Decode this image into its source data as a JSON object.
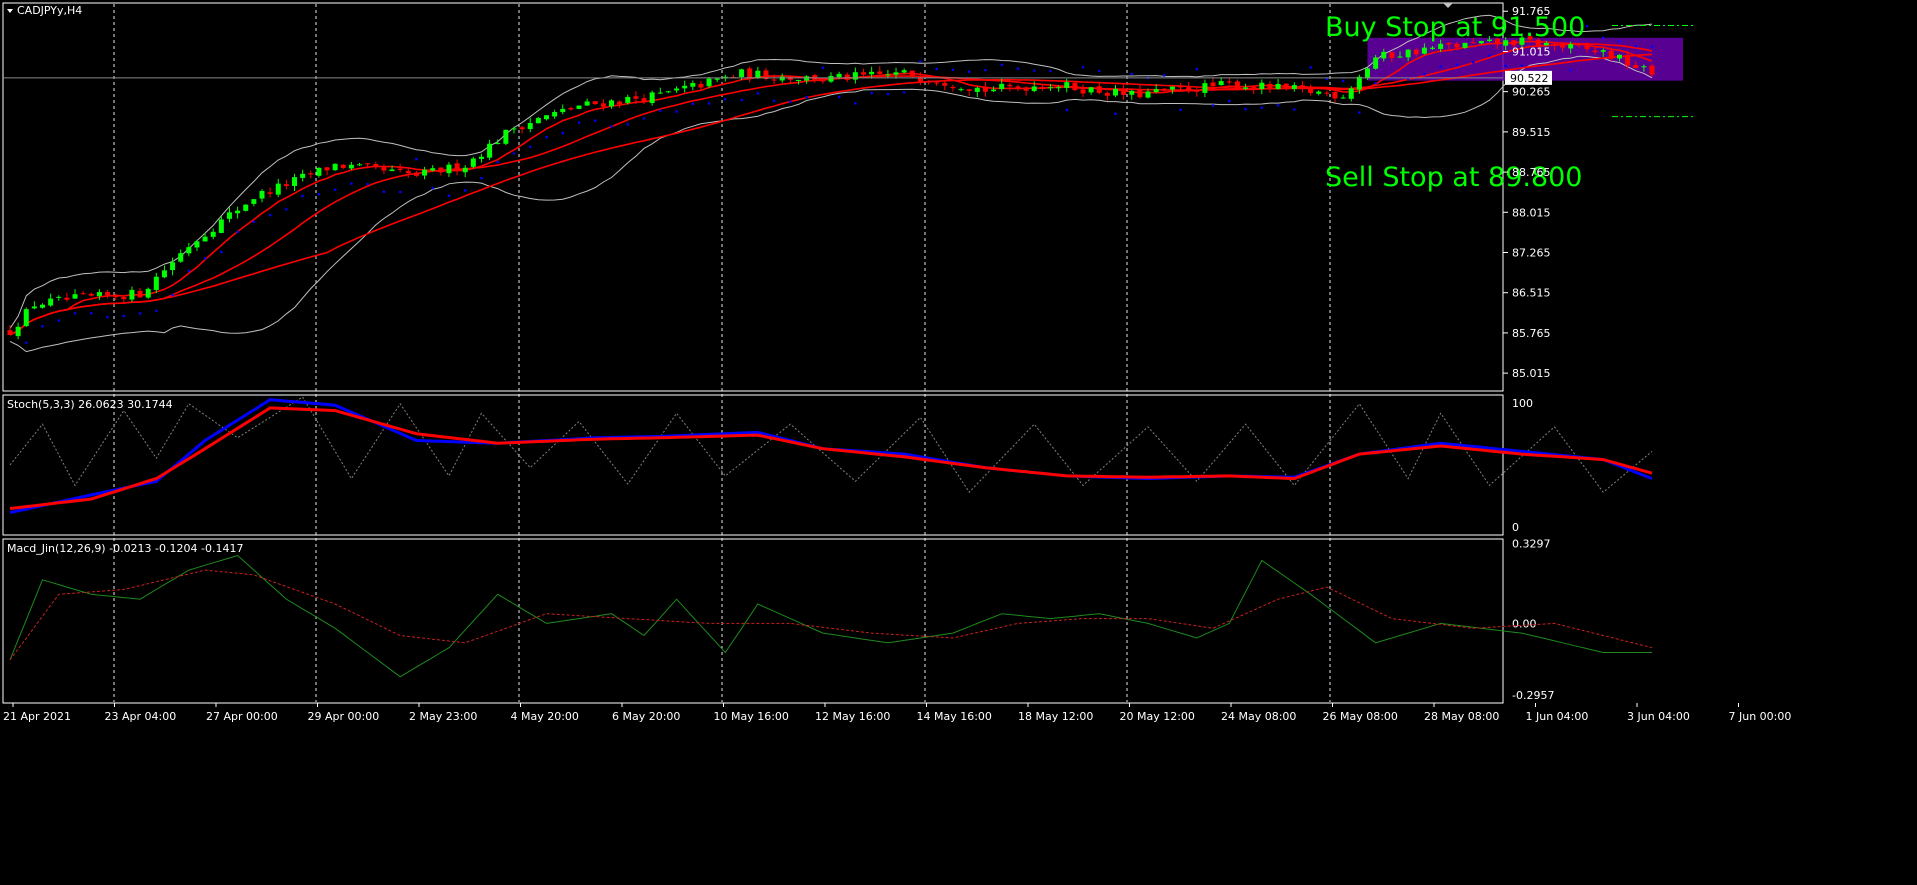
{
  "symbol_label": "CADJPYy,H4",
  "colors": {
    "background": "#000000",
    "frame": "#ffffff",
    "grid": "#ffffff",
    "bull_candle": "#00ff00",
    "bear_candle": "#ff0000",
    "ma_line": "#ff0000",
    "bollinger": "#c0c0c0",
    "sar_dots": "#0000ff",
    "annotation_text": "#00ff00",
    "box_fill": "#6600aa",
    "stoch_main": "#0000ff",
    "stoch_signal": "#ff0000",
    "macd_main": "#1e8a1e",
    "macd_signal": "#c82020",
    "text": "#ffffff"
  },
  "time_labels": [
    "21 Apr 2021",
    "23 Apr 04:00",
    "27 Apr 00:00",
    "29 Apr 00:00",
    "2 May 23:00",
    "4 May 20:00",
    "6 May 20:00",
    "10 May 16:00",
    "12 May 16:00",
    "14 May 16:00",
    "18 May 12:00",
    "20 May 12:00",
    "24 May 08:00",
    "26 May 08:00",
    "28 May 08:00",
    "1 Jun 04:00",
    "3 Jun 04:00",
    "7 Jun 00:00"
  ],
  "chart_data": [
    {
      "type": "candlestick",
      "name": "CADJPYy,H4",
      "ylim": [
        84.7,
        91.9
      ],
      "y_ticks": [
        "91.765",
        "91.015",
        "90.265",
        "89.515",
        "88.765",
        "88.015",
        "87.265",
        "86.515",
        "85.765",
        "85.015"
      ],
      "current_price": "90.522",
      "annotations": [
        "Buy Stop at 91.500",
        "Sell Stop at 89.800"
      ],
      "buy_stop": 91.5,
      "sell_stop": 89.8,
      "trend_anchors": [
        [
          0,
          85.8
        ],
        [
          3,
          86.3
        ],
        [
          8,
          86.4
        ],
        [
          16,
          86.5
        ],
        [
          22,
          87.4
        ],
        [
          30,
          88.3
        ],
        [
          40,
          88.9
        ],
        [
          50,
          88.7
        ],
        [
          56,
          88.9
        ],
        [
          62,
          89.6
        ],
        [
          70,
          90.0
        ],
        [
          80,
          90.2
        ],
        [
          90,
          90.6
        ],
        [
          100,
          90.5
        ],
        [
          110,
          90.6
        ],
        [
          120,
          90.3
        ],
        [
          128,
          90.4
        ],
        [
          138,
          90.2
        ],
        [
          150,
          90.4
        ],
        [
          158,
          90.3
        ],
        [
          164,
          90.2
        ],
        [
          168,
          90.9
        ],
        [
          176,
          91.1
        ],
        [
          186,
          91.2
        ],
        [
          196,
          91.0
        ],
        [
          202,
          90.6
        ]
      ]
    },
    {
      "type": "line",
      "name": "Stoch",
      "title": "Stoch(5,3,3) 26.0623 30.1744",
      "ylim": [
        0,
        100
      ],
      "y_ticks": [
        "100",
        "0"
      ],
      "main_anchors": [
        [
          0,
          15
        ],
        [
          10,
          28
        ],
        [
          18,
          38
        ],
        [
          24,
          68
        ],
        [
          32,
          98
        ],
        [
          40,
          94
        ],
        [
          50,
          68
        ],
        [
          60,
          66
        ],
        [
          72,
          70
        ],
        [
          80,
          71
        ],
        [
          92,
          74
        ],
        [
          100,
          62
        ],
        [
          110,
          58
        ],
        [
          120,
          48
        ],
        [
          130,
          42
        ],
        [
          140,
          40
        ],
        [
          150,
          42
        ],
        [
          158,
          41
        ],
        [
          166,
          58
        ],
        [
          176,
          66
        ],
        [
          186,
          60
        ],
        [
          196,
          54
        ],
        [
          202,
          40
        ]
      ],
      "signal_anchors": [
        [
          0,
          18
        ],
        [
          10,
          25
        ],
        [
          18,
          40
        ],
        [
          24,
          62
        ],
        [
          32,
          92
        ],
        [
          40,
          90
        ],
        [
          50,
          73
        ],
        [
          60,
          66
        ],
        [
          72,
          69
        ],
        [
          80,
          70
        ],
        [
          92,
          72
        ],
        [
          100,
          62
        ],
        [
          110,
          56
        ],
        [
          120,
          48
        ],
        [
          130,
          42
        ],
        [
          140,
          41
        ],
        [
          150,
          42
        ],
        [
          158,
          40
        ],
        [
          166,
          58
        ],
        [
          176,
          64
        ],
        [
          186,
          58
        ],
        [
          196,
          54
        ],
        [
          202,
          44
        ]
      ],
      "dotted_anchors": [
        [
          0,
          50
        ],
        [
          4,
          80
        ],
        [
          8,
          35
        ],
        [
          14,
          90
        ],
        [
          18,
          55
        ],
        [
          22,
          95
        ],
        [
          28,
          70
        ],
        [
          36,
          100
        ],
        [
          42,
          40
        ],
        [
          48,
          95
        ],
        [
          54,
          42
        ],
        [
          58,
          88
        ],
        [
          64,
          48
        ],
        [
          70,
          82
        ],
        [
          76,
          36
        ],
        [
          82,
          88
        ],
        [
          88,
          42
        ],
        [
          96,
          80
        ],
        [
          104,
          38
        ],
        [
          112,
          85
        ],
        [
          118,
          30
        ],
        [
          126,
          80
        ],
        [
          132,
          35
        ],
        [
          140,
          78
        ],
        [
          146,
          38
        ],
        [
          152,
          80
        ],
        [
          158,
          35
        ],
        [
          166,
          95
        ],
        [
          172,
          40
        ],
        [
          176,
          88
        ],
        [
          182,
          35
        ],
        [
          190,
          78
        ],
        [
          196,
          30
        ],
        [
          202,
          60
        ]
      ]
    },
    {
      "type": "line",
      "name": "Macd_Jin",
      "title": "Macd_Jin(12,26,9) -0.0213 -0.1204 -0.1417",
      "ylim": [
        -0.32,
        0.34
      ],
      "y_ticks": [
        "0.3297",
        "0.00",
        "-0.2957"
      ],
      "main_anchors": [
        [
          0,
          -0.15
        ],
        [
          4,
          0.18
        ],
        [
          10,
          0.12
        ],
        [
          16,
          0.1
        ],
        [
          22,
          0.22
        ],
        [
          28,
          0.28
        ],
        [
          34,
          0.1
        ],
        [
          40,
          -0.02
        ],
        [
          48,
          -0.22
        ],
        [
          54,
          -0.1
        ],
        [
          60,
          0.12
        ],
        [
          66,
          0.0
        ],
        [
          74,
          0.04
        ],
        [
          78,
          -0.05
        ],
        [
          82,
          0.1
        ],
        [
          88,
          -0.12
        ],
        [
          92,
          0.08
        ],
        [
          100,
          -0.04
        ],
        [
          108,
          -0.08
        ],
        [
          116,
          -0.04
        ],
        [
          122,
          0.04
        ],
        [
          128,
          0.02
        ],
        [
          134,
          0.04
        ],
        [
          140,
          0.0
        ],
        [
          146,
          -0.06
        ],
        [
          150,
          0.0
        ],
        [
          154,
          0.26
        ],
        [
          160,
          0.12
        ],
        [
          168,
          -0.08
        ],
        [
          176,
          0.0
        ],
        [
          186,
          -0.04
        ],
        [
          196,
          -0.12
        ],
        [
          202,
          -0.12
        ]
      ],
      "signal_anchors": [
        [
          0,
          -0.15
        ],
        [
          6,
          0.12
        ],
        [
          14,
          0.14
        ],
        [
          24,
          0.22
        ],
        [
          30,
          0.2
        ],
        [
          40,
          0.08
        ],
        [
          48,
          -0.05
        ],
        [
          56,
          -0.08
        ],
        [
          66,
          0.04
        ],
        [
          76,
          0.02
        ],
        [
          86,
          0.0
        ],
        [
          96,
          0.0
        ],
        [
          106,
          -0.04
        ],
        [
          116,
          -0.06
        ],
        [
          124,
          0.0
        ],
        [
          132,
          0.02
        ],
        [
          140,
          0.02
        ],
        [
          148,
          -0.02
        ],
        [
          156,
          0.1
        ],
        [
          162,
          0.15
        ],
        [
          170,
          0.02
        ],
        [
          180,
          -0.02
        ],
        [
          190,
          0.0
        ],
        [
          202,
          -0.1
        ]
      ]
    }
  ]
}
